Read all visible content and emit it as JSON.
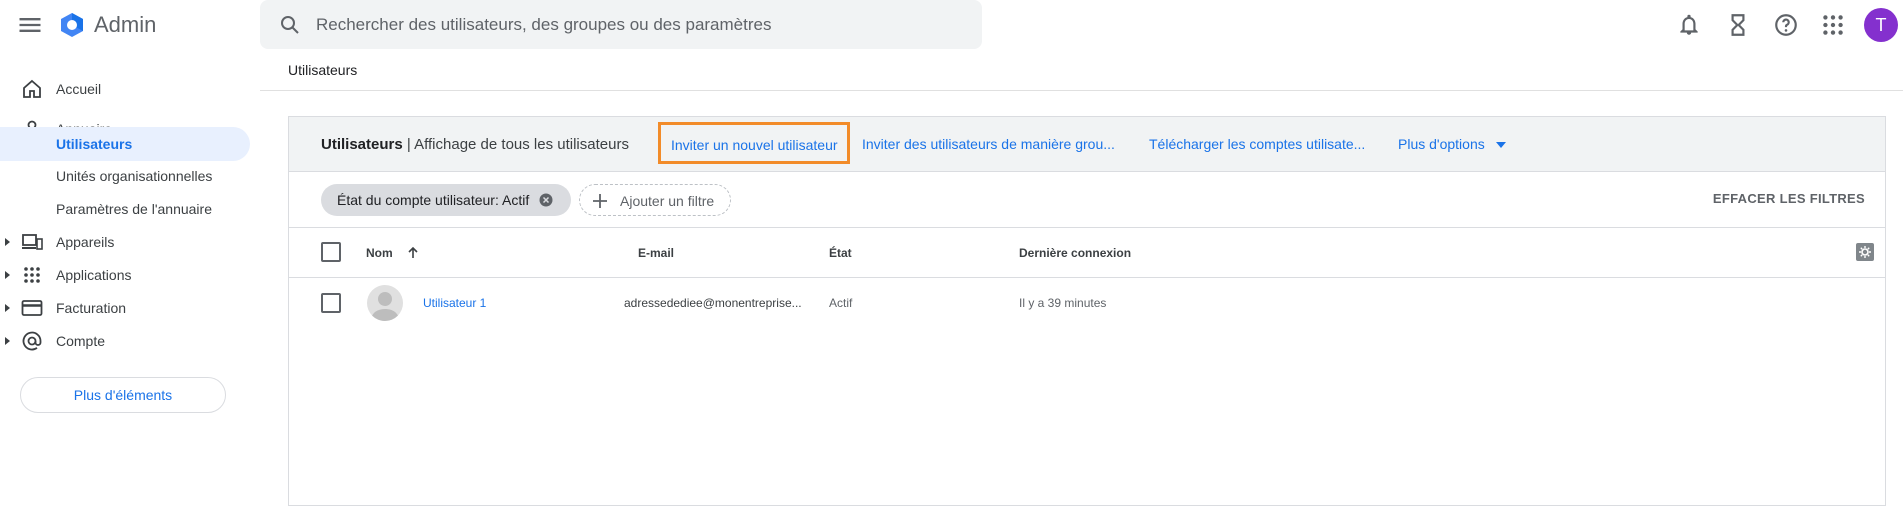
{
  "header": {
    "app_title": "Admin",
    "search_placeholder": "Rechercher des utilisateurs, des groupes ou des paramètres",
    "avatar_initial": "T",
    "avatar_color": "#8430ce"
  },
  "sidebar": {
    "items": [
      {
        "label": "Accueil",
        "icon": "home-icon"
      },
      {
        "label": "Annuaire",
        "icon": "person-icon"
      },
      {
        "label": "Utilisateurs"
      },
      {
        "label": "Unités organisationnelles"
      },
      {
        "label": "Paramètres de l'annuaire"
      },
      {
        "label": "Appareils",
        "icon": "devices-icon"
      },
      {
        "label": "Applications",
        "icon": "apps-grid-icon"
      },
      {
        "label": "Facturation",
        "icon": "credit-card-icon"
      },
      {
        "label": "Compte",
        "icon": "at-sign-icon"
      }
    ],
    "more_label": "Plus d'éléments"
  },
  "breadcrumb": "Utilisateurs",
  "toolbar": {
    "title_bold": "Utilisateurs",
    "title_rest": " | Affichage de tous les utilisateurs",
    "invite_new": "Inviter un nouvel utilisateur",
    "invite_bulk": "Inviter des utilisateurs de manière grou...",
    "download": "Télécharger les comptes utilisate...",
    "more_options": "Plus d'options"
  },
  "filters": {
    "chip": "État du compte utilisateur: Actif",
    "add_filter": "Ajouter un filtre",
    "clear": "EFFACER LES FILTRES"
  },
  "table": {
    "columns": [
      "Nom",
      "E-mail",
      "État",
      "Dernière connexion"
    ],
    "rows": [
      {
        "name": "Utilisateur 1",
        "email": "adressedediee@monentreprise...",
        "status": "Actif",
        "last_login": "Il y a 39 minutes"
      }
    ]
  },
  "colors": {
    "accent": "#1a73e8",
    "highlight_border": "#f28b29",
    "active_nav_bg": "#e8f0fe"
  }
}
